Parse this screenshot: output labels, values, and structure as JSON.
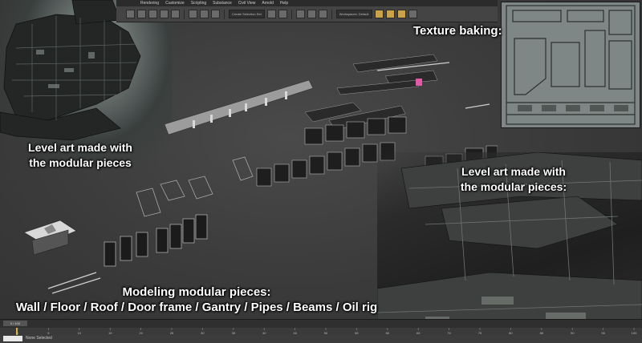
{
  "menubar": {
    "items": [
      "Rendering",
      "Customize",
      "Scripting",
      "Substance",
      "Civil View",
      "Arnold",
      "Help"
    ]
  },
  "toolbar": {
    "dropdown_selection": "Create Selection Set",
    "dropdown_workspace": "Workspaces: Default"
  },
  "captions": {
    "texture_baking": "Texture baking:",
    "level_art_left": [
      "Level art made with",
      "the modular pieces"
    ],
    "level_art_right": [
      "Level art made with",
      "the modular pieces:"
    ],
    "modeling": [
      "Modeling modular pieces:",
      "Wall / Floor / Roof / Door frame / Gantry / Pipes / Beams / Oil rig"
    ]
  },
  "timeline": {
    "slider": "0 / 100",
    "ticks": [
      "0",
      "5",
      "10",
      "15",
      "20",
      "25",
      "30",
      "35",
      "40",
      "45",
      "50",
      "55",
      "60",
      "65",
      "70",
      "75",
      "80",
      "85",
      "90",
      "95",
      "100"
    ]
  },
  "status": {
    "text": "None Selected"
  },
  "colors": {
    "viewport_bg": "#3c3c3c",
    "ui_dark": "#2b2b2b",
    "caption": "#ffffff",
    "highlight_pink": "#e05aa8",
    "timeline_marker": "#d9b44a"
  }
}
